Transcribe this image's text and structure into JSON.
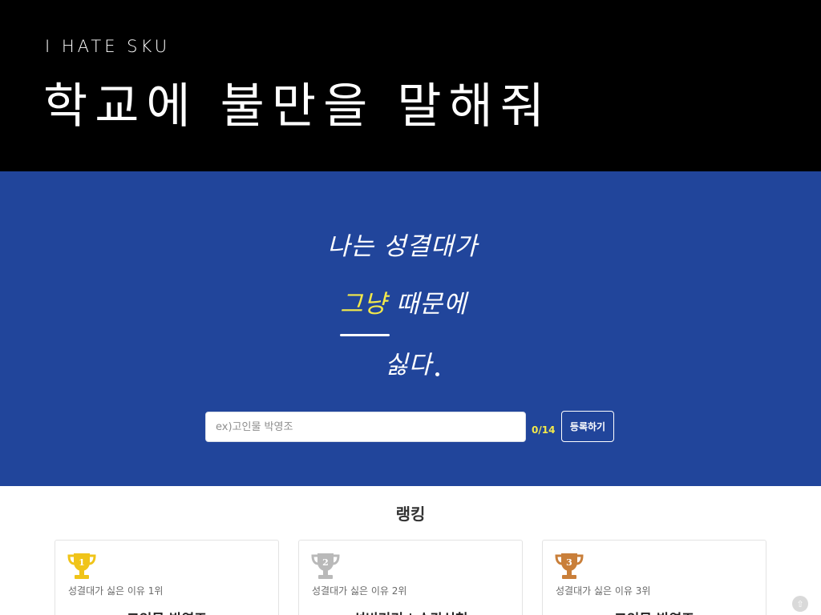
{
  "header": {
    "eyebrow": "I HATE SKU",
    "title": "학교에 불만을 말해줘"
  },
  "hero": {
    "line1": "나는 성결대가",
    "line2_highlight": "그냥",
    "line2_rest": " 때문에",
    "line3": "싫다",
    "highlight_color": "#f3e94a",
    "background_color": "#21459b"
  },
  "form": {
    "placeholder": "ex)고인물 박영조",
    "value": "",
    "counter": "0/14",
    "submit_label": "등록하기"
  },
  "ranking": {
    "heading": "랭킹",
    "cards": [
      {
        "rank": "1",
        "medal": "gold",
        "medal_color": "#f0c419",
        "caption": "성결대가 싫은 이유 1위",
        "reason": "고인물 박영조"
      },
      {
        "rank": "2",
        "medal": "silver",
        "medal_color": "#b9b9b9",
        "caption": "성결대가 싫은 이유 2위",
        "reason": "성빈리리 | 수강신청"
      },
      {
        "rank": "3",
        "medal": "bronze",
        "medal_color": "#c97f3a",
        "caption": "성결대가 싫은 이유 3위",
        "reason": "고인물 박영조"
      }
    ]
  },
  "icons": {
    "trophy": "trophy-icon",
    "corner_badge": "scroll-badge-icon"
  }
}
